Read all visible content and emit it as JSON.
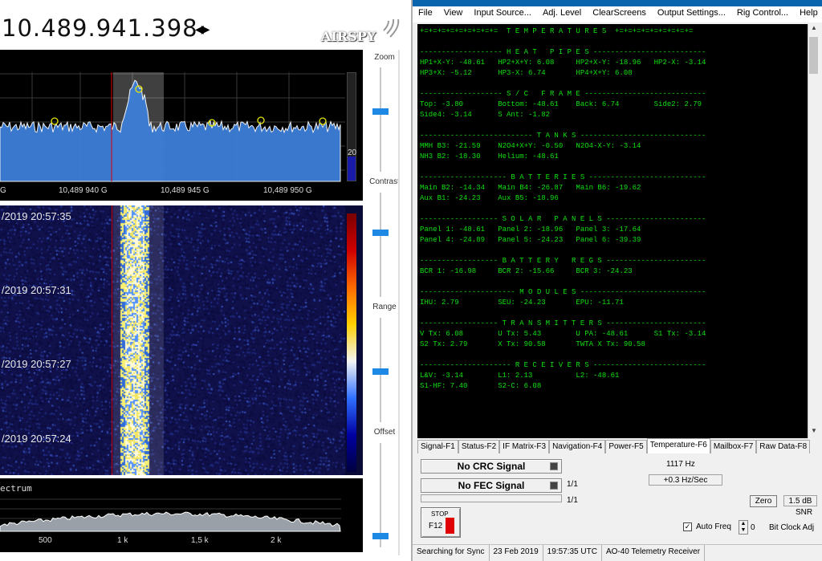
{
  "sdr": {
    "frequency": "10.489.941.398",
    "logo": "AIRSPY",
    "freq_ticks": [
      "G",
      "10,489 940 G",
      "10,489 945 G",
      "10,489 950 G"
    ],
    "colorbar_label": "20",
    "waterfall_times": [
      "/2019 20:57:35",
      "/2019 20:57:31",
      "/2019 20:57:27",
      "/2019 20:57:24"
    ],
    "mini_title": "ectrum",
    "mini_ticks": [
      "500",
      "1 k",
      "1,5 k",
      "2 k"
    ],
    "sliders": [
      {
        "label": "Zoom",
        "level": 0.42
      },
      {
        "label": "Contrast",
        "level": 0.38
      },
      {
        "label": "Range",
        "level": 0.52
      },
      {
        "label": "Offset",
        "level": 0.92
      }
    ]
  },
  "telemetry": {
    "menu": [
      "File",
      "View",
      "Input Source...",
      "Adj. Level",
      "ClearScreens",
      "Output Settings...",
      "Rig Control...",
      "Help"
    ],
    "console_lines": [
      "+=+=+=+=+=+=+=+=+=  T E M P E R A T U R E S  +=+=+=+=+=+=+=+=+=",
      "",
      "------------------- H E A T   P I P E S --------------------------",
      "HP1+X-Y: -48.61   HP2+X+Y: 6.08     HP2+X-Y: -18.96   HP2-X: -3.14",
      "HP3+X: -5.12      HP3-X: 6.74       HP4+X+Y: 6.08",
      "",
      "------------------- S / C   F R A M E ----------------------------",
      "Top: -3.80        Bottom: -48.61    Back: 6.74        Side2: 2.79",
      "Side4: -3.14      S Ant: -1.82",
      "",
      "-------------------------- T A N K S -----------------------------",
      "MMH B3: -21.59    N2O4+X+Y: -0.50   N2O4-X-Y: -3.14",
      "NH3 B2: -18.30    Helium: -48.61",
      "",
      "-------------------- B A T T E R I E S ---------------------------",
      "Main B2: -14.34   Main B4: -26.87   Main B6: -19.62",
      "Aux B1: -24.23    Aux B5: -18.96",
      "",
      "------------------ S O L A R   P A N E L S -----------------------",
      "Panel 1: -48.61   Panel 2: -18.96   Panel 3: -17.64",
      "Panel 4: -24.89   Panel 5: -24.23   Panel 6: -39.39",
      "",
      "------------------ B A T T E R Y   R E G S -----------------------",
      "BCR 1: -16.98     BCR 2: -15.66     BCR 3: -24.23",
      "",
      "---------------------- M O D U L E S -----------------------------",
      "IHU: 2.79         SEU: -24.23       EPU: -11.71",
      "",
      "------------------ T R A N S M I T T E R S -----------------------",
      "V Tx: 6.08        U Tx: 5.43        U PA: -48.61      S1 Tx: -3.14",
      "S2 Tx: 2.79       X Tx: 90.58       TWTA X Tx: 90.58",
      "",
      "--------------------- R E C E I V E R S --------------------------",
      "L&V: -3.14        L1: 2.13          L2: -48.61",
      "S1-HF: 7.40       S2-C: 6.08"
    ],
    "tabs": [
      "Signal-F1",
      "Status-F2",
      "IF Matrix-F3",
      "Navigation-F4",
      "Power-F5",
      "Temperature-F6",
      "Mailbox-F7",
      "Raw Data-F8"
    ],
    "active_tab": "Temperature-F6",
    "crc_signal": "No CRC Signal",
    "fec_signal": "No FEC Signal",
    "freq_hz": "1117 Hz",
    "drift": "+0.3 Hz/Sec",
    "ratio1": "1/1",
    "ratio2": "1/1",
    "stop_label": "STOP",
    "stop_key": "F12",
    "zero_button": "Zero",
    "snr_value": "1.5 dB",
    "snr_label": "SNR",
    "auto_freq_label": "Auto Freq",
    "auto_freq_checked": true,
    "bit_clock_value": "0",
    "bit_clock_label": "Bit Clock Adj",
    "statusbar": [
      "Searching for Sync",
      "23 Feb 2019",
      "19:57:35 UTC",
      "AO-40 Telemetry Receiver"
    ],
    "colors": {
      "console_text": "#10e010",
      "stop_indicator": "#e00000",
      "slider_handle": "#1e88e5"
    }
  }
}
